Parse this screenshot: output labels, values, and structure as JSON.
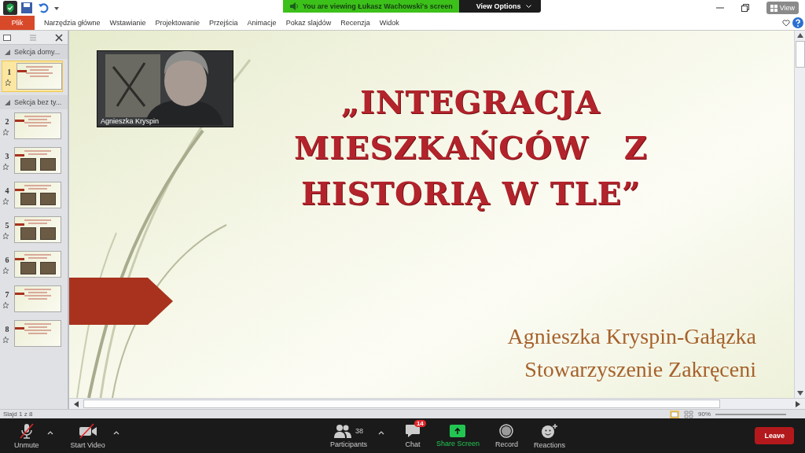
{
  "share_banner": {
    "message": "You are viewing Łukasz Wachowski's screen",
    "options": "View Options"
  },
  "window_controls": {
    "view_label": "View"
  },
  "ribbon": {
    "file_tab": "Plik",
    "tabs": [
      "Narzędzia główne",
      "Wstawianie",
      "Projektowanie",
      "Przejścia",
      "Animacje",
      "Pokaz slajdów",
      "Recenzja",
      "Widok"
    ]
  },
  "slide_panel": {
    "sections": [
      {
        "title": "Sekcja domy...",
        "slides": [
          {
            "number": "1",
            "selected": true,
            "kind": "text"
          }
        ]
      },
      {
        "title": "Sekcja bez ty...",
        "slides": [
          {
            "number": "2",
            "selected": false,
            "kind": "text"
          },
          {
            "number": "3",
            "selected": false,
            "kind": "photos"
          },
          {
            "number": "4",
            "selected": false,
            "kind": "photos"
          },
          {
            "number": "5",
            "selected": false,
            "kind": "photos"
          },
          {
            "number": "6",
            "selected": false,
            "kind": "photos"
          },
          {
            "number": "7",
            "selected": false,
            "kind": "text"
          },
          {
            "number": "8",
            "selected": false,
            "kind": "text"
          }
        ]
      }
    ]
  },
  "slide": {
    "title_lines": [
      "„INTEGRACJA",
      "MIESZKAŃCÓW   Z",
      "HISTORIĄ W TLE”"
    ],
    "author": "Agnieszka Kryspin-Gałązka",
    "organization": "Stowarzyszenie Zakręceni"
  },
  "video": {
    "name": "Agnieszka Kryspin"
  },
  "status_bar": {
    "slide_counter": "Slajd 1 z 8",
    "zoom": "90%"
  },
  "toolbar": {
    "left": [
      {
        "label": "Unmute",
        "kind": "mic",
        "caret": true
      },
      {
        "label": "Start Video",
        "kind": "video",
        "caret": true
      }
    ],
    "center": [
      {
        "label": "Participants",
        "kind": "participants",
        "count": "38",
        "caret": true
      },
      {
        "label": "Chat",
        "kind": "chat",
        "badge": "14"
      },
      {
        "label": "Share Screen",
        "kind": "share"
      },
      {
        "label": "Record",
        "kind": "record"
      },
      {
        "label": "Reactions",
        "kind": "reactions"
      }
    ],
    "leave": "Leave"
  }
}
